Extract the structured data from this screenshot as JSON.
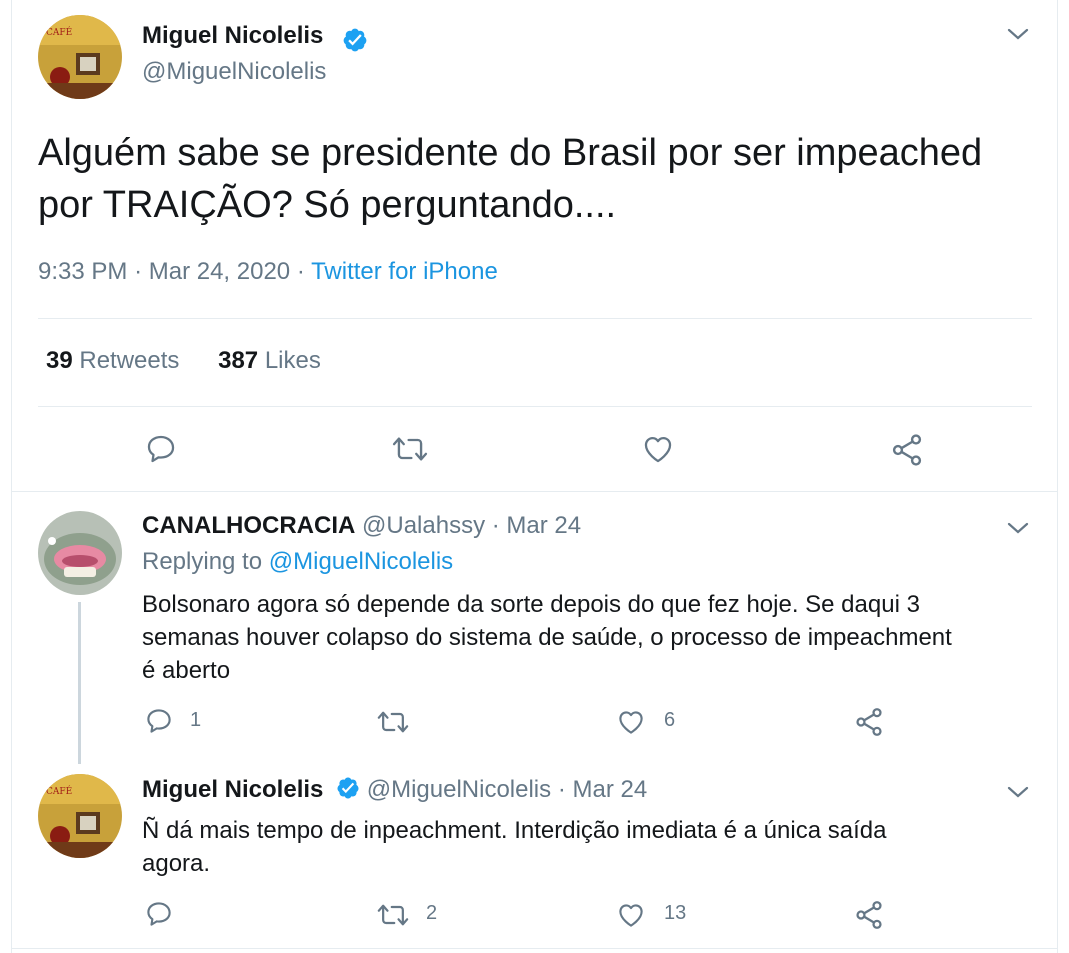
{
  "main_tweet": {
    "author_name": "Miguel Nicolelis",
    "handle": "@MiguelNicolelis",
    "text_line1": "Alguém sabe se presidente do Brasil por ser impeached",
    "text_line2": "por TRAIÇÃO? Só perguntando....",
    "time": "9:33 PM",
    "sep1": "·",
    "date": "Mar 24, 2020",
    "sep2": "·",
    "source": "Twitter for iPhone",
    "retweets_count": "39",
    "retweets_label": "Retweets",
    "likes_count": "387",
    "likes_label": "Likes"
  },
  "reply1": {
    "author_name": "CANALHOCRACIA",
    "handle": "@Ualahssy",
    "sep": "·",
    "date": "Mar 24",
    "replying_label": "Replying to",
    "replying_handle": "@MiguelNicolelis",
    "text_line1": "Bolsonaro agora só depende da sorte depois do que fez hoje. Se daqui 3",
    "text_line2": "semanas houver colapso do sistema de saúde, o processo de impeachment",
    "text_line3": "é aberto",
    "reply_count": "1",
    "retweet_count": "",
    "like_count": "6"
  },
  "reply2": {
    "author_name": "Miguel Nicolelis",
    "handle": "@MiguelNicolelis",
    "sep": "·",
    "date": "Mar 24",
    "text_line1": "Ñ dá mais tempo de inpeachment. Interdição imediata é a única saída",
    "text_line2": "agora.",
    "reply_count": "",
    "retweet_count": "2",
    "like_count": "13"
  },
  "colors": {
    "text": "#14171a",
    "muted": "#657786",
    "link": "#1b95e0",
    "verified": "#1da1f2",
    "divider": "#e6ecf0"
  }
}
